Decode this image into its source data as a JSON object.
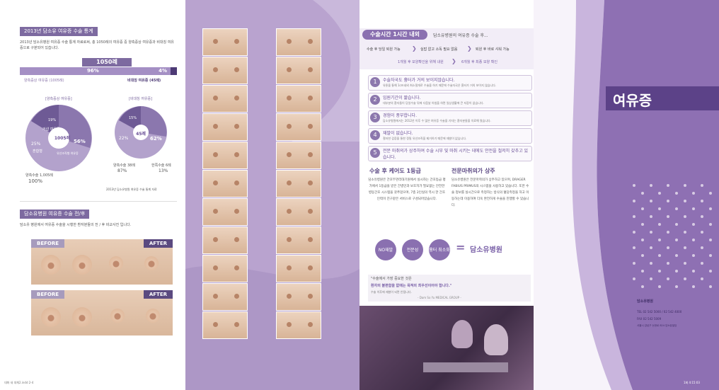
{
  "left": {
    "stats_header": "2013년 담소유 여유증 수술 통계",
    "stats_intro": "2013년 담소유병원 여유증 수술 통계 자료로써, 총 1050례의 여유증 중 양측증상 여유증과 비대칭 여유증으로 구분되어 있습니다.",
    "total_label": "1050례",
    "bar_left_pct": "96%",
    "bar_right_pct": "4%",
    "bar_left_caption": "양측증상 여유증 (1005례)",
    "bar_right_caption": "비대칭 여유증 (45례)",
    "donut1_title": "[양측증상 여유증]",
    "donut1_center": "1005례",
    "donut1_segments": [
      "19%",
      "거샵 여유증",
      "25%",
      "혼합형",
      "56%",
      "유선조직형 여유증"
    ],
    "donut1_bottom_label": "양측수술 1,005례",
    "donut1_bottom_pct": "100%",
    "donut2_title": "[비대칭 여유증]",
    "donut2_center": "45례",
    "donut2_segments": [
      "15%",
      "22%",
      "62%"
    ],
    "donut2_left_label": "양측수술 38례",
    "donut2_left_pct": "87%",
    "donut2_right_label": "한쪽수술 6례",
    "donut2_right_pct": "13%",
    "donut_source": "2013년 담소유병원 여유증 수술 통계 자료",
    "ba_header": "담소유병원 여유증 수술 전/후",
    "ba_intro": "담소유 병원에서 여유증 수술을 시행한 환자분들의 전 / 후 비교사진 입니다.",
    "before": "BEFORE",
    "after": "AFTER",
    "footer": "대화 새 대체2.indd 2-4"
  },
  "right": {
    "time_badge": "수술시간 1시간 내외",
    "time_tagline": "담소유병원의 여유증 수술 후...",
    "flow1": [
      "수술 후 당일 퇴원 가능",
      "실밥 없고 소독 필요 없음",
      "퇴원 후 바로 샤워 가능"
    ],
    "flow2": [
      "1개월 후 모양확인을 위해 내원",
      "6개월 후 최종 모양 확인"
    ],
    "items": [
      {
        "num": "1",
        "title": "수술자국도 흉터가 거의 보이지않습니다.",
        "desc": "유륜을 통해 1cm내외 최소절개로 수술을 하기 때문에 수술자국은 흉터가 거의 보이지 않습니다."
      },
      {
        "num": "2",
        "title": "입원기간이 짧습니다.",
        "desc": "대부분의 환자들이 당일수술 뒤에 다음날 아침을 하면 일상생활에 큰 지장이 없습니다."
      },
      {
        "num": "3",
        "title": "경험이 풍부합니다.",
        "desc": "담소유병원에서는 2012년 이후 수 많은 여유증 수술을 기자는 환자분들을 치료해 왔습니다."
      },
      {
        "num": "4",
        "title": "재발이 없습니다.",
        "desc": "철저한 검증을 통한 정밀 유선조직을 제거하기 때문에 재발이 없습니다."
      },
      {
        "num": "5",
        "title": "전문 마취의가 상주하여 수술 시부 및 마취 시키는 데에도 안전을 철저히 갖추고 있습니다.",
        "desc": ""
      }
    ],
    "care_title": "수술 후 케어도 1등급",
    "care_body": "담소유병원은 간호부관리대기원에서 실시하는 간호등급 평가에서 1등급을 받은 간병인과 보호자가 필요없는 안전한 병동간호 시스템을 갖추었으며, 7층 2인실의 역시 한 간호인력이 친구같은 서비스로 구성되어있습니다.",
    "anes_title": "전문마취의가 상주",
    "anes_body": "담소유병원은 전문마취의가 상주하고 있으며, DRAGER FABIUS PRIMUS의 시스템을 사용하고 있습니다. 또한 수술 정보를 실시간으로 측정하는 방식의 혈당측정을 하고 이동하는데 이용하여 더욱 완전하게 수술을 진행할 수 있습니다.",
    "badges": [
      "NO재발",
      "전문성",
      "흉터 최소화"
    ],
    "equals": "=",
    "brand": "담소유병원",
    "quote_line1": "\"수술에서 가장 중요한 것은",
    "quote_line2": "환자의 불편함을 없애는 목적의 최우선이어야 합니다.\"",
    "quote_line3": "수술 이후에 재발이 되면 안됩니다.",
    "quote_sign": "- Dam So Yu MEDICAL GROUP -"
  },
  "cover": {
    "title": "여유증",
    "clinic": "담소유병원",
    "contact1": "TEL 02 542 5000 / 02 542 4000",
    "contact2": "FAX 02 542 5009",
    "address": "서울시 강남구 논현로 824 담소유빌딩",
    "footer": "1회 4:15:03"
  }
}
